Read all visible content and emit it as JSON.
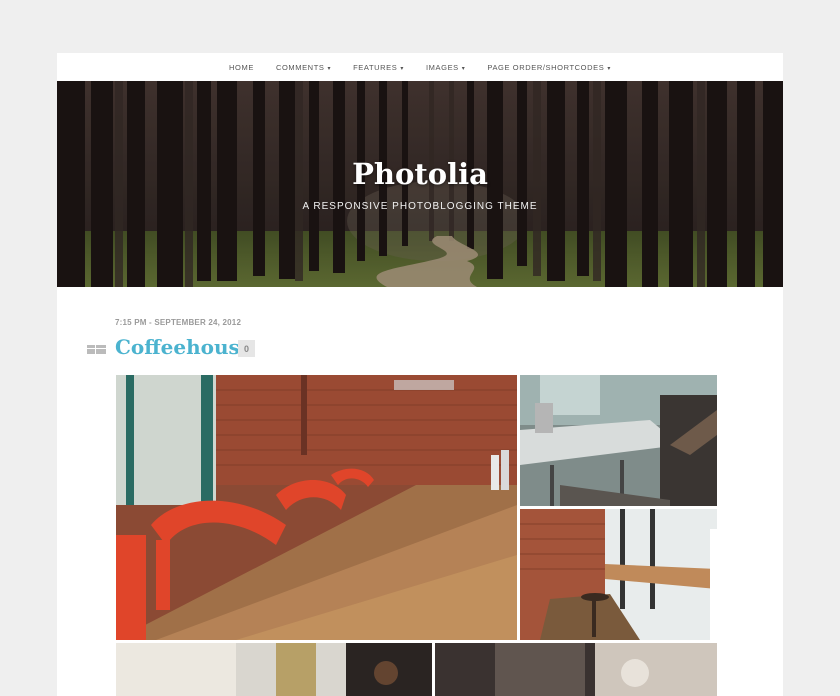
{
  "nav": {
    "items": [
      {
        "label": "HOME",
        "has_dropdown": false
      },
      {
        "label": "COMMENTS",
        "has_dropdown": true
      },
      {
        "label": "FEATURES",
        "has_dropdown": true
      },
      {
        "label": "IMAGES",
        "has_dropdown": true
      },
      {
        "label": "PAGE ORDER/SHORTCODES",
        "has_dropdown": true
      }
    ]
  },
  "header": {
    "site_title": "Photolia",
    "tagline": "A RESPONSIVE PHOTOBLOGGING THEME"
  },
  "post": {
    "date": "7:15 PM - SEPTEMBER 24, 2012",
    "title": "Coffeehouse",
    "comment_count": "0",
    "format_icon": "gallery-format-icon"
  },
  "colors": {
    "accent": "#4bb3cf",
    "background": "#efefef",
    "page": "#ffffff"
  }
}
